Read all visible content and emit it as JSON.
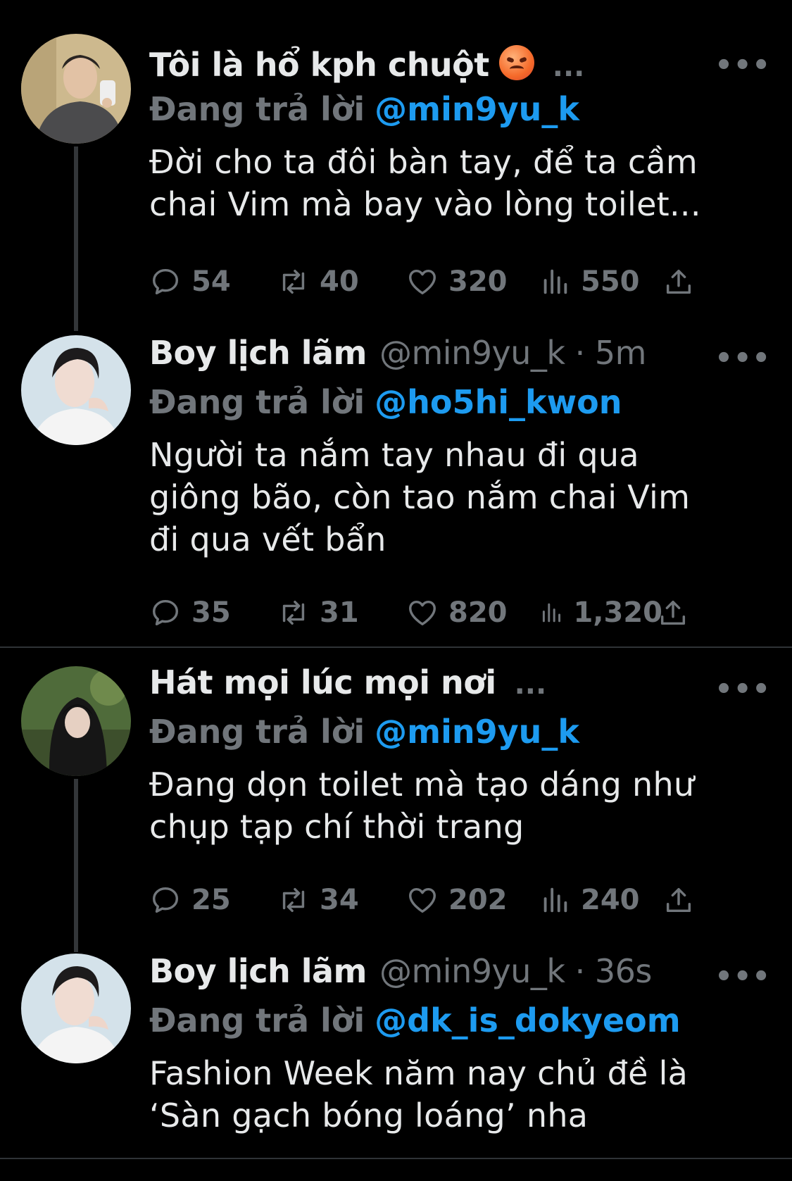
{
  "tweets": [
    {
      "name": "Tôi là hổ kph chuột",
      "has_emoji": true,
      "emoji_icon": "angry-face-emoji",
      "handle": "",
      "time": "",
      "name_ellipsis": "...",
      "reply_label": "Đang trả lời",
      "reply_to": "@min9yu_k",
      "text": "Đời cho ta đôi bàn tay, để ta cầm\nchai Vim mà bay vào lòng toilet...",
      "replies": "54",
      "retweets": "40",
      "likes": "320",
      "views": "550"
    },
    {
      "name": "Boy lịch lãm",
      "handle": "@min9yu_k · 5m",
      "reply_label": "Đang trả lời",
      "reply_to": "@ho5hi_kwon",
      "text": "Người ta nắm tay nhau đi qua\ngiông bão, còn tao nắm chai Vim\nđi qua vết bẩn",
      "replies": "35",
      "retweets": "31",
      "likes": "820",
      "views": "1,320"
    },
    {
      "name": "Hát mọi lúc mọi nơi",
      "name_ellipsis": "...",
      "reply_label": "Đang trả lời",
      "reply_to": "@min9yu_k",
      "text": "Đang dọn toilet mà tạo dáng như\nchụp tạp chí thời trang",
      "replies": "25",
      "retweets": "34",
      "likes": "202",
      "views": "240"
    },
    {
      "name": "Boy lịch lãm",
      "handle": "@min9yu_k · 36s",
      "reply_label": "Đang trả lời",
      "reply_to": "@dk_is_dokyeom",
      "text": "Fashion Week năm nay chủ đề là\n‘Sàn gạch bóng loáng’ nha"
    }
  ],
  "more_label": "•••",
  "colors": {
    "background": "#000000",
    "text": "#e7e9ea",
    "muted": "#71767b",
    "mention": "#1d9bf0",
    "divider": "#2f3336"
  }
}
